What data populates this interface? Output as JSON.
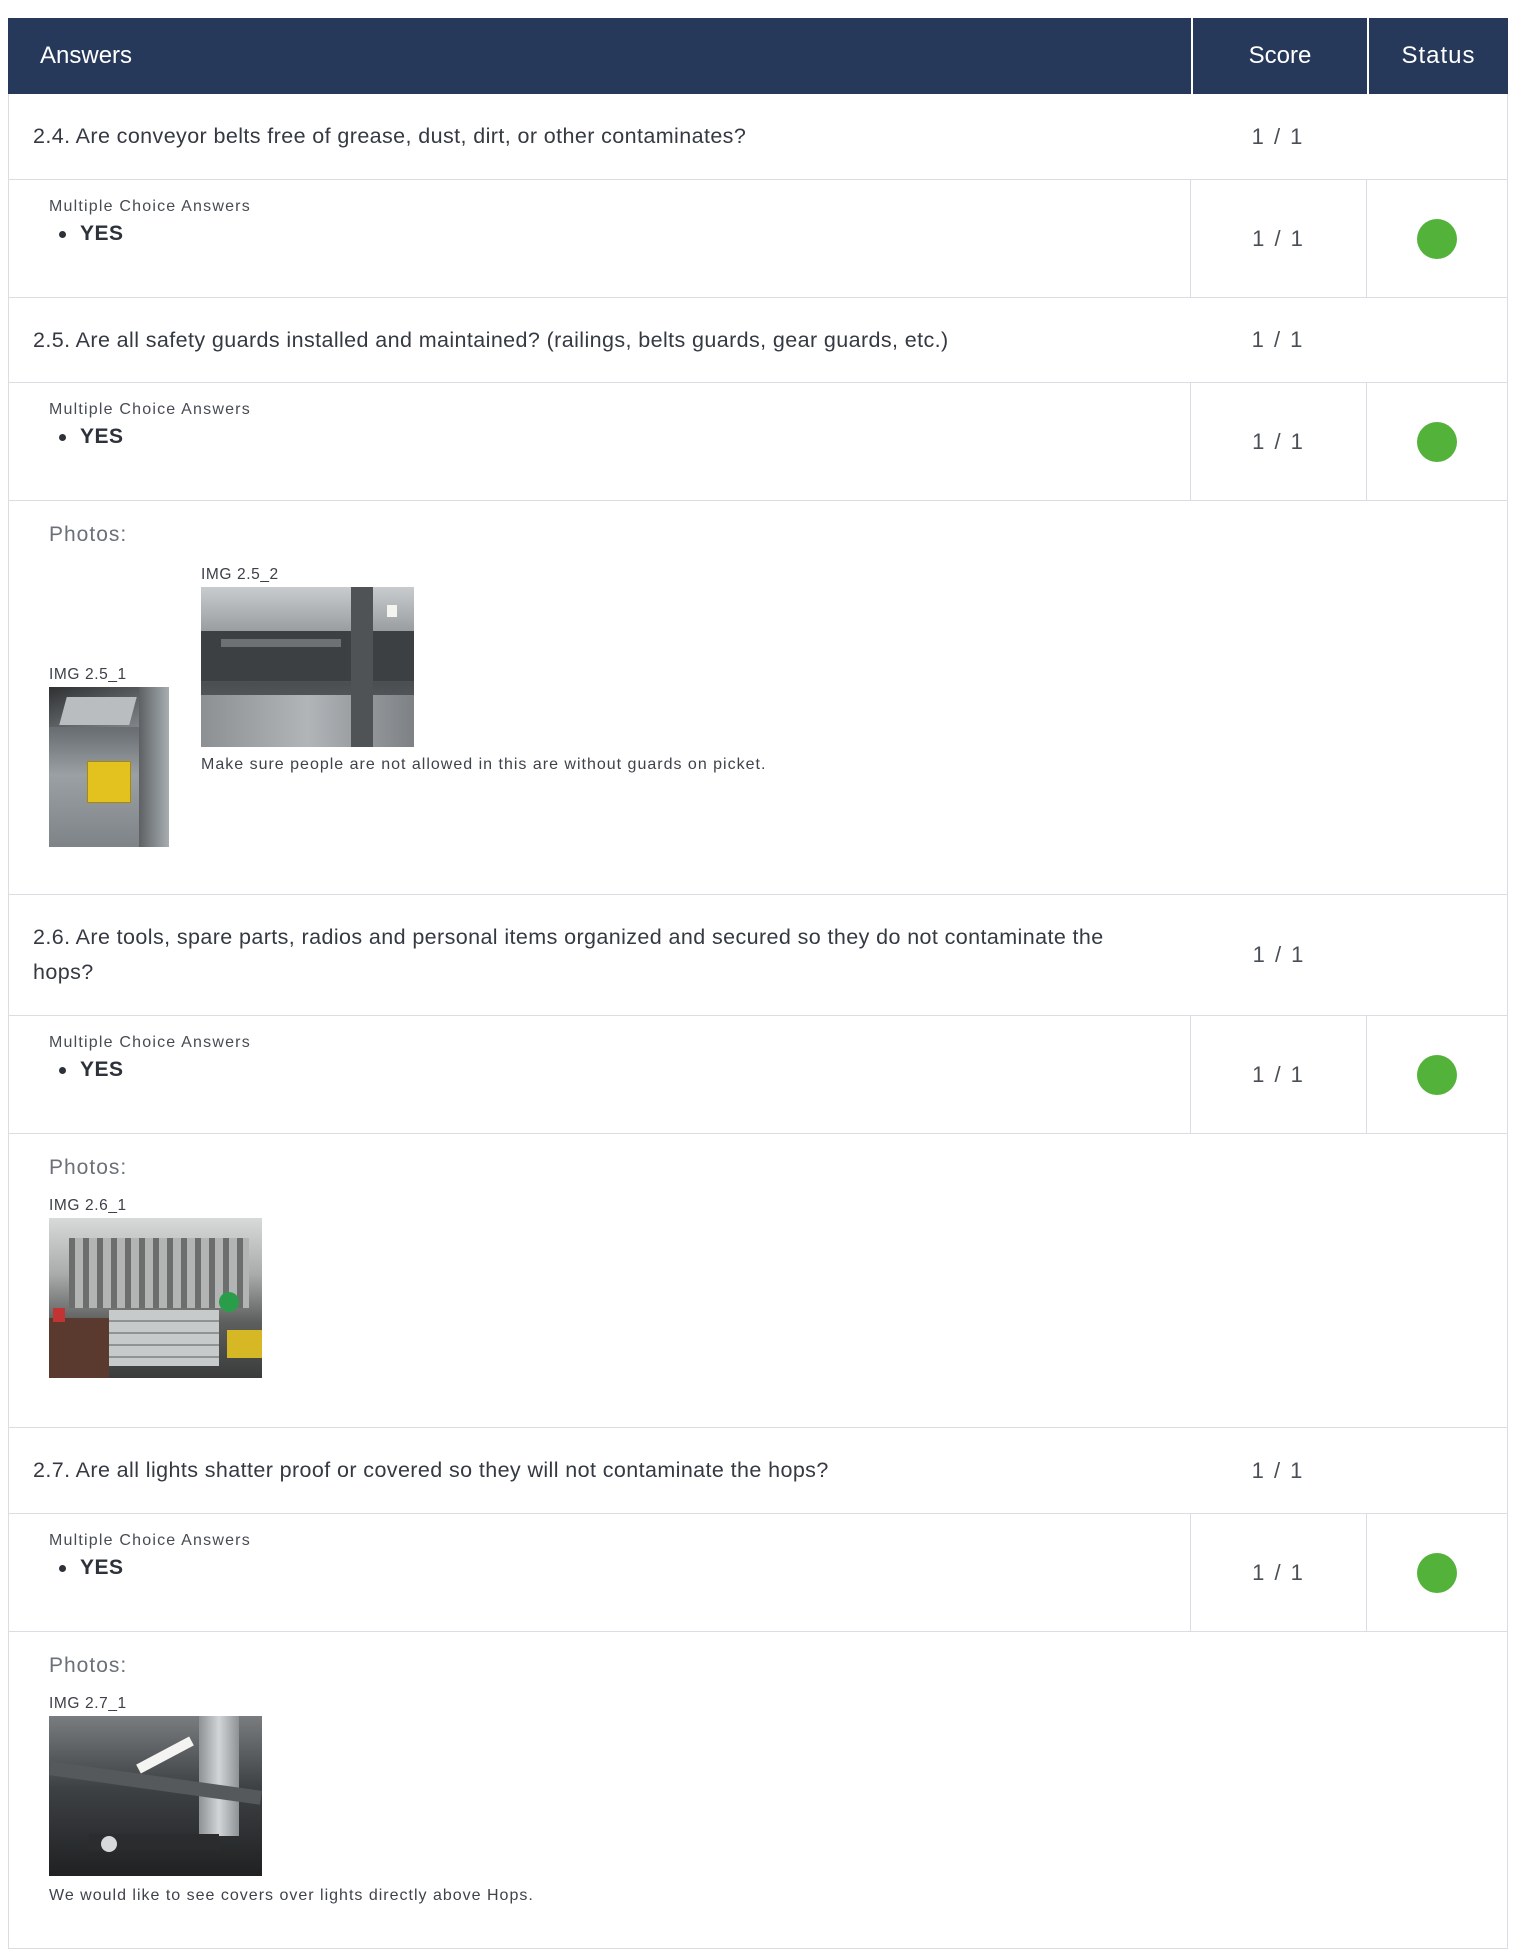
{
  "header": {
    "answers": "Answers",
    "score": "Score",
    "status": "Status"
  },
  "items": [
    {
      "question": "2.4. Are conveyor belts free of grease, dust, dirt, or other contaminates?",
      "score": "1 / 1",
      "answer_label": "Multiple Choice Answers",
      "answer": "YES",
      "answer_score": "1 / 1",
      "status_color": "#53b23a"
    },
    {
      "question": "2.5. Are all safety guards installed and maintained? (railings, belts guards, gear guards, etc.)",
      "score": "1 / 1",
      "answer_label": "Multiple Choice Answers",
      "answer": "YES",
      "answer_score": "1 / 1",
      "status_color": "#53b23a",
      "photos_label": "Photos:",
      "photos": [
        {
          "caption": "IMG 2.5_1"
        },
        {
          "caption": "IMG 2.5_2"
        }
      ],
      "note": "Make sure people are not allowed in this are without guards on picket."
    },
    {
      "question": "2.6. Are tools, spare parts, radios and personal items organized and secured so they do not contaminate the hops?",
      "score": "1 / 1",
      "answer_label": "Multiple Choice Answers",
      "answer": "YES",
      "answer_score": "1 / 1",
      "status_color": "#53b23a",
      "photos_label": "Photos:",
      "photos": [
        {
          "caption": "IMG 2.6_1"
        }
      ]
    },
    {
      "question": "2.7. Are all lights shatter proof or covered so they will not contaminate the hops?",
      "score": "1 / 1",
      "answer_label": "Multiple Choice Answers",
      "answer": "YES",
      "answer_score": "1 / 1",
      "status_color": "#53b23a",
      "photos_label": "Photos:",
      "photos": [
        {
          "caption": "IMG 2.7_1"
        }
      ],
      "note": "We would like to see covers over lights directly above Hops."
    }
  ]
}
